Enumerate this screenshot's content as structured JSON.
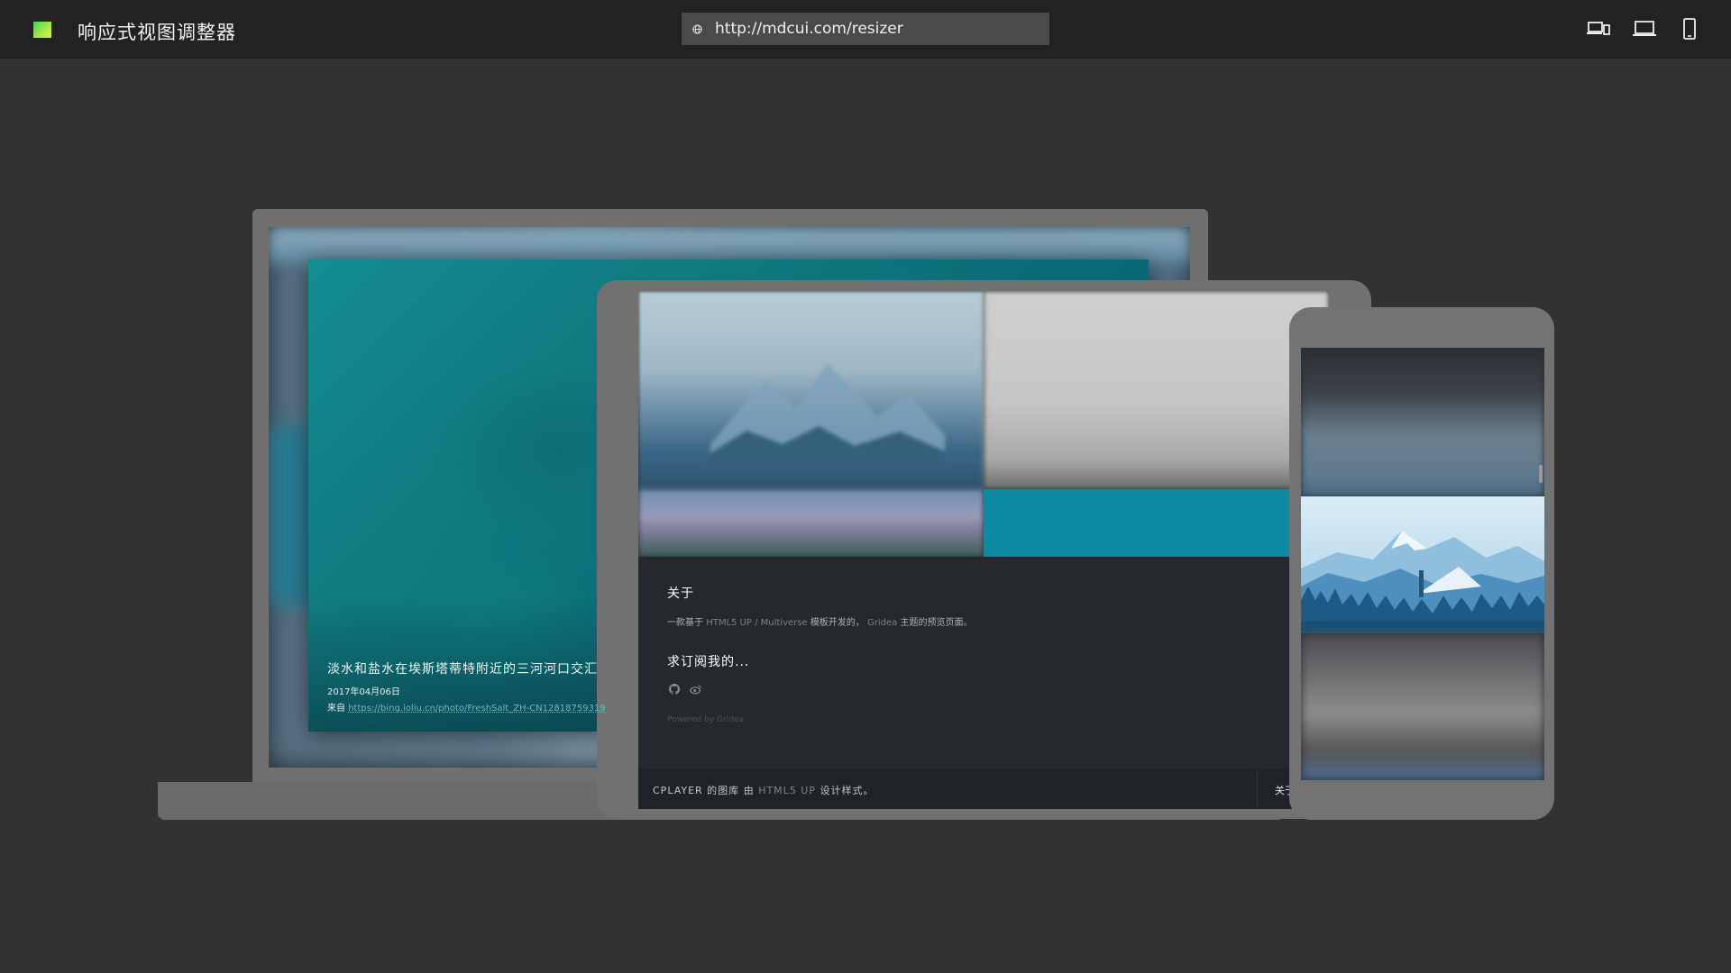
{
  "app": {
    "title": "响应式视图调整器",
    "url": "http://mdcui.com/resizer",
    "device_buttons": [
      {
        "name": "responsive",
        "icon": "devices-icon"
      },
      {
        "name": "laptop",
        "icon": "laptop-icon"
      },
      {
        "name": "phone",
        "icon": "smartphone-icon"
      }
    ]
  },
  "laptop": {
    "caption": "淡水和盐水在埃斯塔蒂特附近的三河河口交汇",
    "date": "2017年04月06日",
    "source_prefix": "来自",
    "source_link": "https://bing.ioliu.cn/photo/FreshSalt_ZH-CN12818759319"
  },
  "tablet": {
    "about_title": "关于",
    "about_desc_1": "一款基于",
    "about_desc_template": "HTML5 UP / Multiverse",
    "about_desc_2": "模板开发的，",
    "about_desc_theme": "Gridea",
    "about_desc_3": "主题的预览页面。",
    "subscribe_title": "求订阅我的...",
    "social_icons": [
      "github-icon",
      "weibo-icon"
    ],
    "powered_text": "Powered by Gridea",
    "footer_brand": "CPLAYER 的图库",
    "footer_by": "由",
    "footer_template": "HTML5 UP",
    "footer_suffix": "设计样式。",
    "footer_about": "关于"
  },
  "colors": {
    "topbar": "#222222",
    "background": "#323232",
    "device_frame": "#707070",
    "accent_teal": "#0c8aa3"
  }
}
